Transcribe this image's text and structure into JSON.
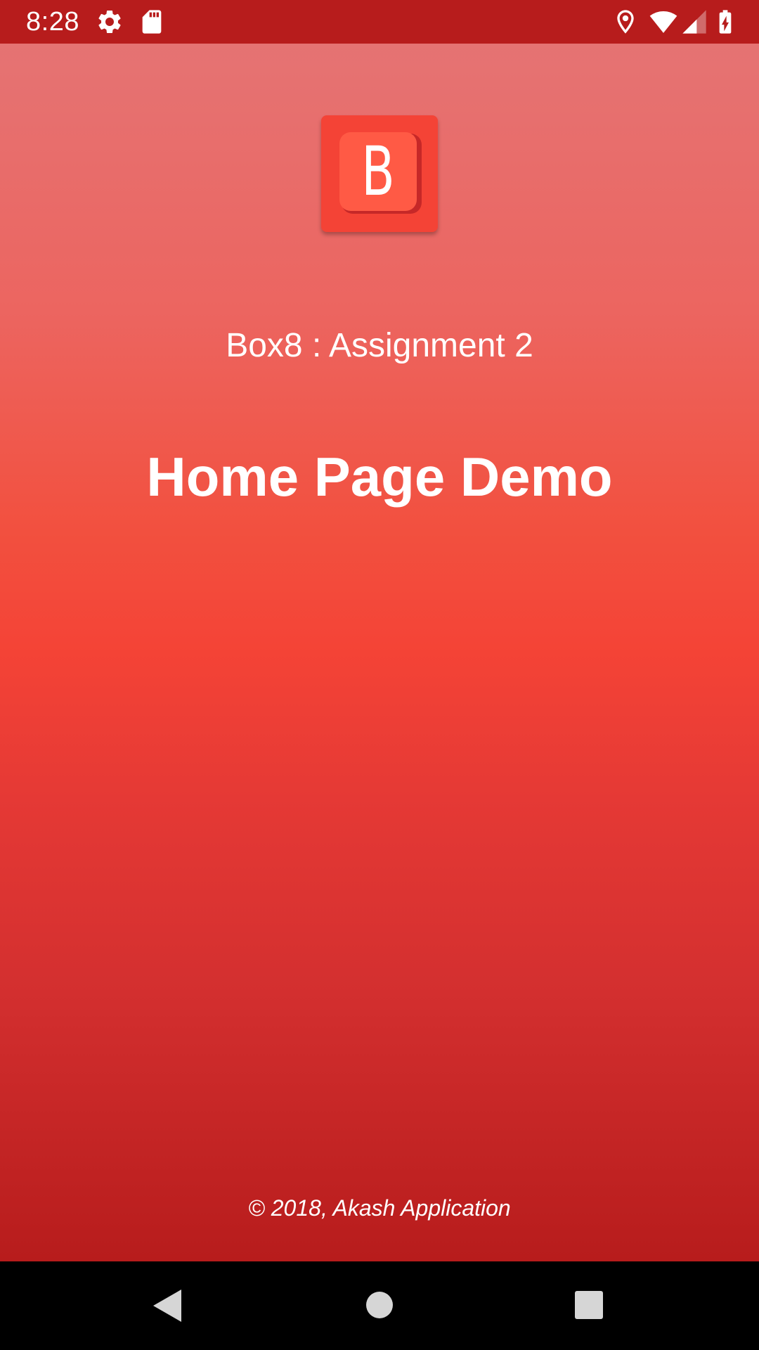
{
  "status_bar": {
    "time": "8:28",
    "left_icons": [
      "gear-icon",
      "sd-card-icon"
    ],
    "right_icons": [
      "location-pin-icon",
      "wifi-icon",
      "cell-signal-icon",
      "battery-charging-icon"
    ],
    "background": "#b71c1c"
  },
  "logo": {
    "letter": "B",
    "color": "#f44336"
  },
  "main": {
    "subtitle": "Box8 : Assignment 2",
    "title": "Home Page Demo",
    "footer": "© 2018, Akash Application",
    "gradient_colors": [
      "#e57373",
      "#f44336",
      "#b71c1c"
    ]
  },
  "nav_bar": {
    "buttons": [
      "back-icon",
      "home-icon",
      "recents-icon"
    ]
  }
}
